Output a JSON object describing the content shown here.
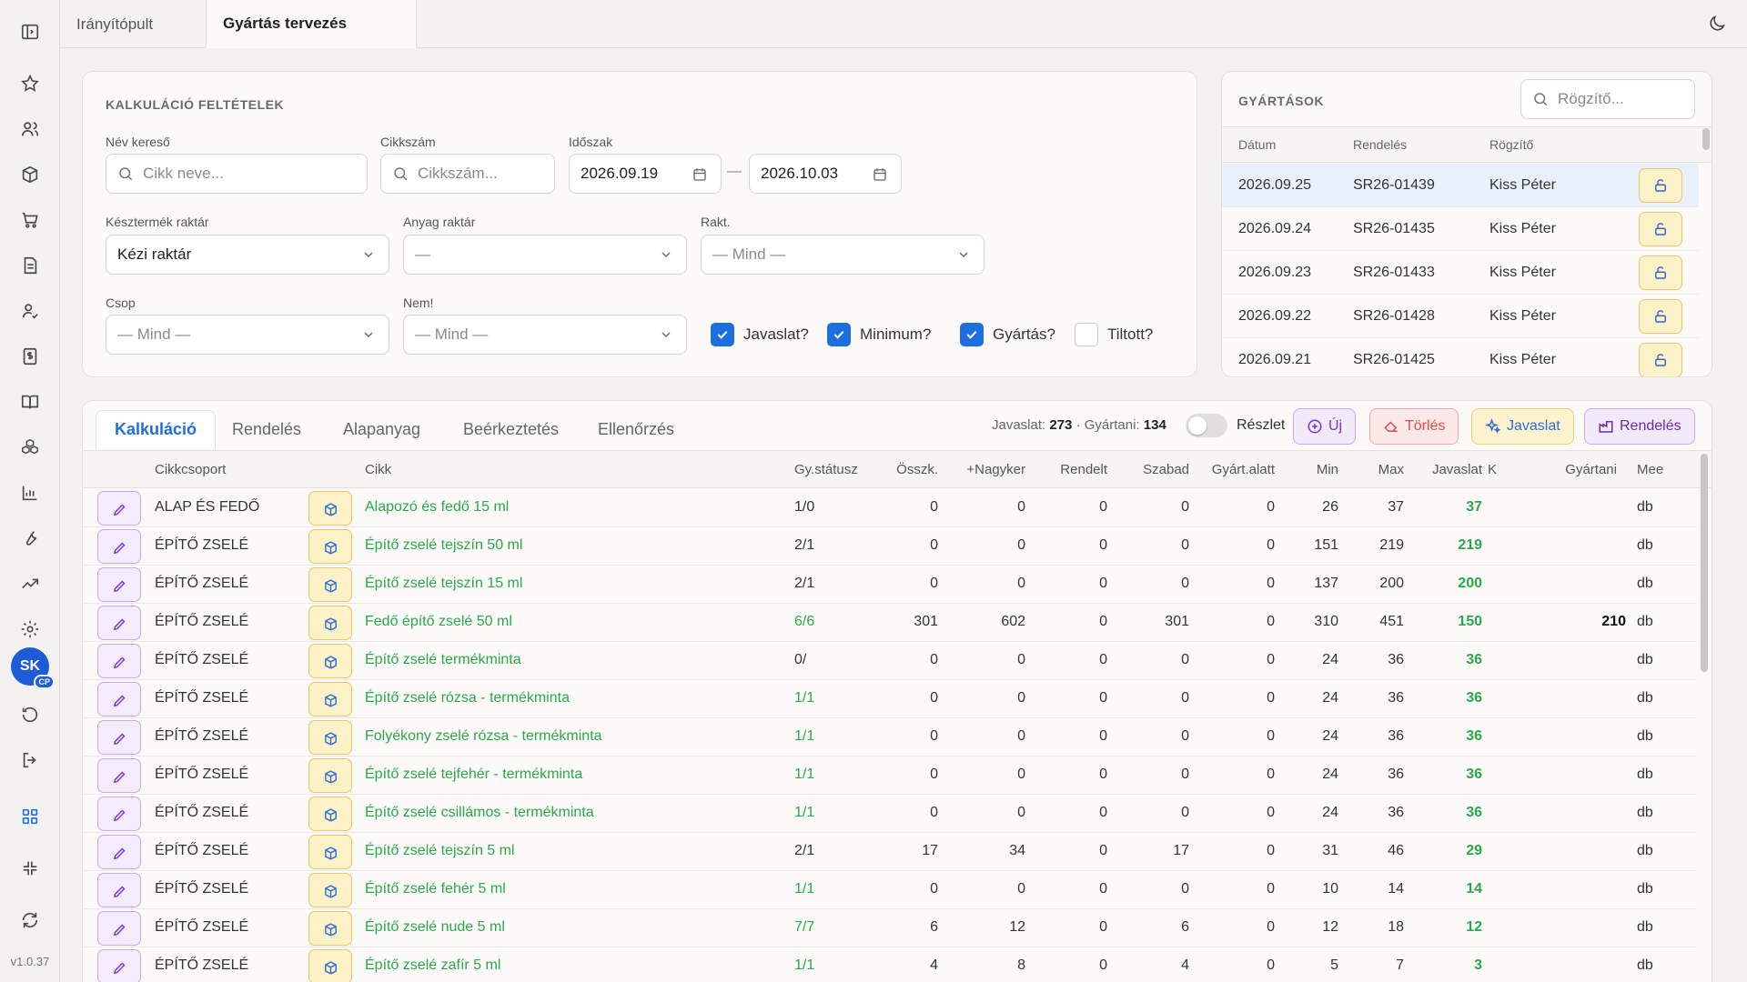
{
  "app": {
    "version": "v1.0.37",
    "avatar_initials": "SK",
    "avatar_badge": "CP"
  },
  "top_tabs": [
    {
      "label": "Irányítópult",
      "active": false
    },
    {
      "label": "Gyártás tervezés",
      "active": true
    }
  ],
  "filters": {
    "title": "KALKULÁCIÓ FELTÉTELEK",
    "name_label": "Név kereső",
    "name_placeholder": "Cikk neve...",
    "sku_label": "Cikkszám",
    "sku_placeholder": "Cikkszám...",
    "period_label": "Időszak",
    "date_from": "2026.09.19",
    "date_to": "2026.10.03",
    "date_sep": "—",
    "finished_wh_label": "Késztermék raktár",
    "finished_wh_value": "Kézi raktár",
    "material_wh_label": "Anyag raktár",
    "material_wh_value": "—",
    "rakt_label": "Rakt.",
    "rakt_value": "— Mind —",
    "csop_label": "Csop",
    "csop_value": "— Mind —",
    "nem_label": "Nem!",
    "nem_value": "— Mind —",
    "checkboxes": [
      {
        "label": "Javaslat?",
        "checked": true
      },
      {
        "label": "Minimum?",
        "checked": true
      },
      {
        "label": "Gyártás?",
        "checked": true
      },
      {
        "label": "Tiltott?",
        "checked": false
      }
    ]
  },
  "productions": {
    "title": "GYÁRTÁSOK",
    "search_placeholder": "Rögzítő...",
    "columns": [
      "Dátum",
      "Rendelés",
      "Rögzítő"
    ],
    "rows": [
      {
        "date": "2026.09.25",
        "order": "SR26-01439",
        "by": "Kiss Péter",
        "selected": true
      },
      {
        "date": "2026.09.24",
        "order": "SR26-01435",
        "by": "Kiss Péter",
        "selected": false
      },
      {
        "date": "2026.09.23",
        "order": "SR26-01433",
        "by": "Kiss Péter",
        "selected": false
      },
      {
        "date": "2026.09.22",
        "order": "SR26-01428",
        "by": "Kiss Péter",
        "selected": false
      },
      {
        "date": "2026.09.21",
        "order": "SR26-01425",
        "by": "Kiss Péter",
        "selected": false
      }
    ]
  },
  "main": {
    "tabs": [
      {
        "label": "Kalkuláció",
        "active": true
      },
      {
        "label": "Rendelés",
        "active": false
      },
      {
        "label": "Alapanyag",
        "active": false
      },
      {
        "label": "Beérkeztetés",
        "active": false
      },
      {
        "label": "Ellenőrzés",
        "active": false
      }
    ],
    "stats": {
      "javaslat_label": "Javaslat:",
      "javaslat_value": "273",
      "gyartani_label": "· Gyártani:",
      "gyartani_value": "134"
    },
    "detail_toggle_label": "Részlet",
    "detail_toggle_on": false,
    "buttons": {
      "new": "Új",
      "delete": "Törlés",
      "suggest": "Javaslat",
      "order": "Rendelés"
    },
    "columns": [
      "Cikkcsoport",
      "Cikk",
      "Gy.státusz",
      "Összk.",
      "+Nagyker",
      "Rendelt",
      "Szabad",
      "Gyárt.alatt",
      "Min",
      "Max",
      "Javaslat",
      "K",
      "Gyártani",
      "Mee"
    ],
    "rows": [
      {
        "group": "ALAP ÉS FEDŐ",
        "item": "Alapozó és fedő 15 ml",
        "status": "1/0",
        "status_green": false,
        "total": "0",
        "wholesale": "0",
        "ordered": "0",
        "free": "0",
        "in_prod": "0",
        "min": "26",
        "max": "37",
        "suggest": "37",
        "produce": "",
        "unit": "db"
      },
      {
        "group": "ÉPÍTŐ ZSELÉ",
        "item": "Építő zselé tejszín 50 ml",
        "status": "2/1",
        "status_green": false,
        "total": "0",
        "wholesale": "0",
        "ordered": "0",
        "free": "0",
        "in_prod": "0",
        "min": "151",
        "max": "219",
        "suggest": "219",
        "produce": "",
        "unit": "db"
      },
      {
        "group": "ÉPÍTŐ ZSELÉ",
        "item": "Építő zselé tejszín 15 ml",
        "status": "2/1",
        "status_green": false,
        "total": "0",
        "wholesale": "0",
        "ordered": "0",
        "free": "0",
        "in_prod": "0",
        "min": "137",
        "max": "200",
        "suggest": "200",
        "produce": "",
        "unit": "db"
      },
      {
        "group": "ÉPÍTŐ ZSELÉ",
        "item": "Fedő építő zselé 50 ml",
        "status": "6/6",
        "status_green": true,
        "total": "301",
        "wholesale": "602",
        "ordered": "0",
        "free": "301",
        "in_prod": "0",
        "min": "310",
        "max": "451",
        "suggest": "150",
        "produce": "210",
        "unit": "db"
      },
      {
        "group": "ÉPÍTŐ ZSELÉ",
        "item": "Építő zselé termékminta",
        "status": "0/",
        "status_green": false,
        "total": "0",
        "wholesale": "0",
        "ordered": "0",
        "free": "0",
        "in_prod": "0",
        "min": "24",
        "max": "36",
        "suggest": "36",
        "produce": "",
        "unit": "db"
      },
      {
        "group": "ÉPÍTŐ ZSELÉ",
        "item": "Építő zselé rózsa - termékminta",
        "status": "1/1",
        "status_green": true,
        "total": "0",
        "wholesale": "0",
        "ordered": "0",
        "free": "0",
        "in_prod": "0",
        "min": "24",
        "max": "36",
        "suggest": "36",
        "produce": "",
        "unit": "db"
      },
      {
        "group": "ÉPÍTŐ ZSELÉ",
        "item": "Folyékony zselé rózsa - termékminta",
        "status": "1/1",
        "status_green": true,
        "total": "0",
        "wholesale": "0",
        "ordered": "0",
        "free": "0",
        "in_prod": "0",
        "min": "24",
        "max": "36",
        "suggest": "36",
        "produce": "",
        "unit": "db"
      },
      {
        "group": "ÉPÍTŐ ZSELÉ",
        "item": "Építő zselé tejfehér - termékminta",
        "status": "1/1",
        "status_green": true,
        "total": "0",
        "wholesale": "0",
        "ordered": "0",
        "free": "0",
        "in_prod": "0",
        "min": "24",
        "max": "36",
        "suggest": "36",
        "produce": "",
        "unit": "db"
      },
      {
        "group": "ÉPÍTŐ ZSELÉ",
        "item": "Építő zselé csillámos - termékminta",
        "status": "1/1",
        "status_green": true,
        "total": "0",
        "wholesale": "0",
        "ordered": "0",
        "free": "0",
        "in_prod": "0",
        "min": "24",
        "max": "36",
        "suggest": "36",
        "produce": "",
        "unit": "db"
      },
      {
        "group": "ÉPÍTŐ ZSELÉ",
        "item": "Építő zselé tejszín 5 ml",
        "status": "2/1",
        "status_green": false,
        "total": "17",
        "wholesale": "34",
        "ordered": "0",
        "free": "17",
        "in_prod": "0",
        "min": "31",
        "max": "46",
        "suggest": "29",
        "produce": "",
        "unit": "db"
      },
      {
        "group": "ÉPÍTŐ ZSELÉ",
        "item": "Építő zselé fehér 5 ml",
        "status": "1/1",
        "status_green": true,
        "total": "0",
        "wholesale": "0",
        "ordered": "0",
        "free": "0",
        "in_prod": "0",
        "min": "10",
        "max": "14",
        "suggest": "14",
        "produce": "",
        "unit": "db"
      },
      {
        "group": "ÉPÍTŐ ZSELÉ",
        "item": "Építő zselé nude 5 ml",
        "status": "7/7",
        "status_green": true,
        "total": "6",
        "wholesale": "12",
        "ordered": "0",
        "free": "6",
        "in_prod": "0",
        "min": "12",
        "max": "18",
        "suggest": "12",
        "produce": "",
        "unit": "db"
      },
      {
        "group": "ÉPÍTŐ ZSELÉ",
        "item": "Építő zselé zafír 5 ml",
        "status": "1/1",
        "status_green": true,
        "total": "4",
        "wholesale": "8",
        "ordered": "0",
        "free": "4",
        "in_prod": "0",
        "min": "5",
        "max": "7",
        "suggest": "3",
        "produce": "",
        "unit": "db"
      }
    ]
  }
}
